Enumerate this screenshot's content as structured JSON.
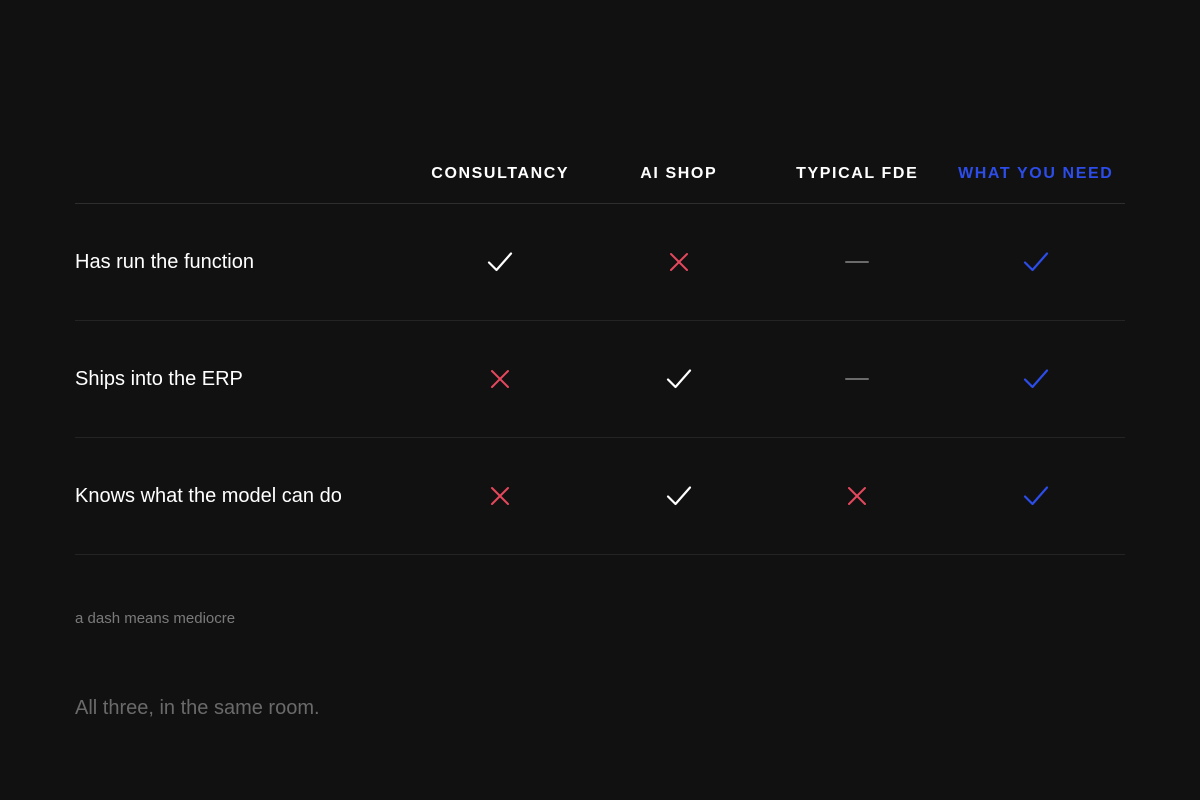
{
  "table": {
    "columns": [
      {
        "label": "CONSULTANCY",
        "highlight": false
      },
      {
        "label": "AI SHOP",
        "highlight": false
      },
      {
        "label": "TYPICAL FDE",
        "highlight": false
      },
      {
        "label": "WHAT YOU NEED",
        "highlight": true
      }
    ],
    "rows": [
      {
        "label": "Has run the function",
        "cells": [
          "check",
          "cross",
          "dash",
          "check"
        ]
      },
      {
        "label": "Ships into the ERP",
        "cells": [
          "cross",
          "check",
          "dash",
          "check"
        ]
      },
      {
        "label": "Knows what the model can do",
        "cells": [
          "cross",
          "check",
          "cross",
          "check"
        ]
      }
    ]
  },
  "footnote": "a dash means mediocre",
  "tagline": "All three, in the same room.",
  "colors": {
    "background": "#111111",
    "check": "#ffffff",
    "cross": "#e5485d",
    "dash": "#6b6b6b",
    "highlight": "#2c4dea"
  },
  "icons": {
    "check": "check-icon",
    "cross": "cross-icon",
    "dash": "dash-icon"
  }
}
